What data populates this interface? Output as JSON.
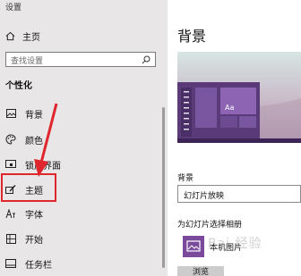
{
  "app": {
    "title": "设置"
  },
  "sidebar": {
    "home_label": "主页",
    "search_placeholder": "查找设置",
    "section_title": "个性化",
    "items": [
      {
        "label": "背景",
        "icon": "image-icon"
      },
      {
        "label": "颜色",
        "icon": "palette-icon"
      },
      {
        "label": "锁屏界面",
        "icon": "lock-screen-icon"
      },
      {
        "label": "主题",
        "icon": "brush-icon"
      },
      {
        "label": "字体",
        "icon": "font-icon"
      },
      {
        "label": "开始",
        "icon": "start-icon"
      },
      {
        "label": "任务栏",
        "icon": "taskbar-icon"
      }
    ]
  },
  "main": {
    "title": "背景",
    "preview_sample_text": "Aa",
    "background_label": "背景",
    "background_value": "幻灯片放映",
    "album_label": "为幻灯片选择相册",
    "album_name": "本机图片",
    "browse_button": "浏览"
  },
  "watermark": "Bai 经验",
  "colors": {
    "sidebar_bg": "#e8e6e6",
    "highlight": "#e0262d",
    "accent_purple": "#7a4b9d"
  }
}
